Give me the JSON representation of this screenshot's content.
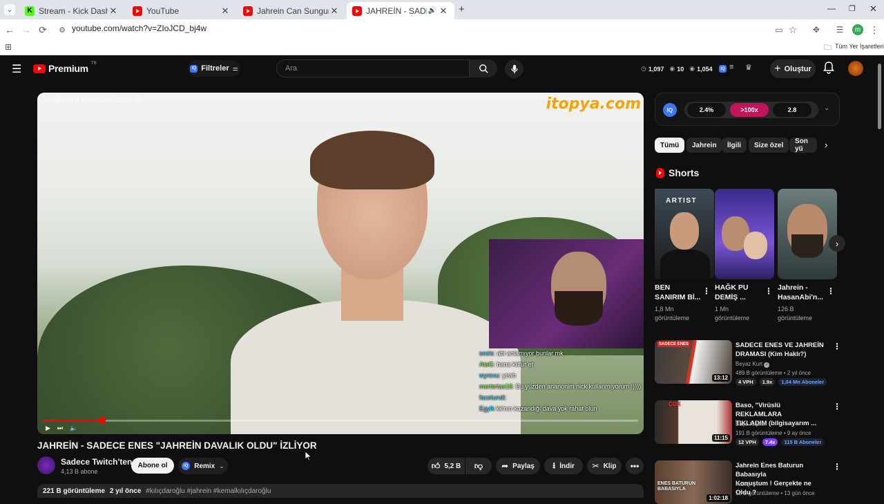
{
  "browser": {
    "tabs": [
      {
        "title": "Stream - Kick Dashboard",
        "favicon": "kick-icon",
        "active": false
      },
      {
        "title": "YouTube",
        "favicon": "youtube-icon",
        "active": false
      },
      {
        "title": "Jahrein Can Sungur İle Geçmişi",
        "favicon": "youtube-icon",
        "active": false
      },
      {
        "title": "JAHREİN - SADECE ENES \"JA",
        "favicon": "youtube-icon",
        "active": true
      }
    ],
    "url": "youtube.com/watch?v=ZIoJCD_bj4w",
    "bookmarks_label": "Tüm Yer İşaretleri",
    "profile_initial": "m"
  },
  "youtube_header": {
    "logo_text": "Premium",
    "region": "TR",
    "filters_label": "Filtreler",
    "search_placeholder": "Ara",
    "stats": {
      "s1": "1,097",
      "s2": "10",
      "s3": "1,054"
    },
    "create_label": "Oluştur"
  },
  "video": {
    "overlay_title": "JAHREİN'E DAVALIK OLDU 😂",
    "overlay_logo": "itopya.com",
    "progress_fraction": 0.1,
    "chat": [
      {
        "user": "sosis",
        "text": "abi anlamıyor bunlar mk"
      },
      {
        "user": "AtaG",
        "text": "bana küfür et"
      },
      {
        "user": "wyrexu",
        "text": "yeah"
      },
      {
        "user": "mertertas16",
        "text": "Bu yüzden ananonim nick kullanmıyorum :))))"
      },
      {
        "user": "facetundt",
        "text": ""
      },
      {
        "user": "Egylk",
        "text": "kk'nın kazandığı dava yok rahat olun"
      }
    ]
  },
  "video_info": {
    "title": "JAHREİN - SADECE ENES \"JAHREİN DAVALIK OLDU\" İZLİYOR",
    "channel_name": "Sadece Twitch'ten",
    "channel_subs": "4,13 B abone",
    "subscribe_label": "Abone ol",
    "remix_label": "Remix",
    "like_count": "5,2 B",
    "share_label": "Paylaş",
    "download_label": "İndir",
    "clip_label": "Klip",
    "views": "221 B görüntüleme",
    "age": "2 yıl önce",
    "tags": "#kılıçdaroğlu #jahrein #kemalkılıçdaroğlu"
  },
  "iq_panel": {
    "logo": "IQ",
    "seg1": "2.4%",
    "seg2": ">100x",
    "seg3": "2.8"
  },
  "chips": [
    "Tümü",
    "Jahrein",
    "İlgili",
    "Size özel",
    "Son yü"
  ],
  "shorts": {
    "heading": "Shorts",
    "items": [
      {
        "title_line1": "BEN",
        "title_line2": "SANIRIM Bİ...",
        "views_line1": "1,8 Mn",
        "views_line2": "görüntüleme",
        "overlay": "ARTIST"
      },
      {
        "title_line1": "HAĞK PU",
        "title_line2": "DEMİŞ ...",
        "views_line1": "1 Mn",
        "views_line2": "görüntüleme",
        "overlay": ""
      },
      {
        "title_line1": "Jahrein -",
        "title_line2": "HasanAbi'n...",
        "views_line1": "126 B",
        "views_line2": "görüntüleme",
        "overlay": ""
      }
    ]
  },
  "recommendations": [
    {
      "title_line1": "SADECE ENES VE JAHREİN",
      "title_line2": "DRAMASI (Kim Haklı?)",
      "channel": "Beyaz Kurt",
      "meta": "489 B görüntüleme • 2 yıl önce",
      "duration": "13:12",
      "vph": "4 VPH",
      "ratio": "1.9x",
      "subs": "1,04 Mn Aboneler",
      "thumb_label": "SADECE ENES"
    },
    {
      "title_line1": "Baso, \"Virüslü REKLAMLARA",
      "title_line2": "TIKLADIM (bilgisayarım ...",
      "channel": "Başo Klipleri",
      "meta": "191 B görüntüleme • 9 ay önce",
      "duration": "11:15",
      "vph": "12 VPH",
      "ratio": "7.4x",
      "subs": "115 B Aboneler",
      "thumb_label": "ÇOK"
    },
    {
      "title_line1": "Jahrein Enes Baturun Babasıyla",
      "title_line2": "Konuştum ! Gerçekte ne Oldu ?",
      "channel": "KickQ",
      "meta": "12 B görüntüleme • 13 gün önce",
      "duration": "1:02:18",
      "vph": "",
      "ratio": "",
      "subs": "",
      "thumb_label": "ENES BATURUN BABASIYLA"
    }
  ],
  "colors": {
    "accent_red": "#ff0000",
    "badge_purple": "#7b3ff2",
    "iq_pink": "#c0155a",
    "iq_blue": "#3a78ff"
  }
}
